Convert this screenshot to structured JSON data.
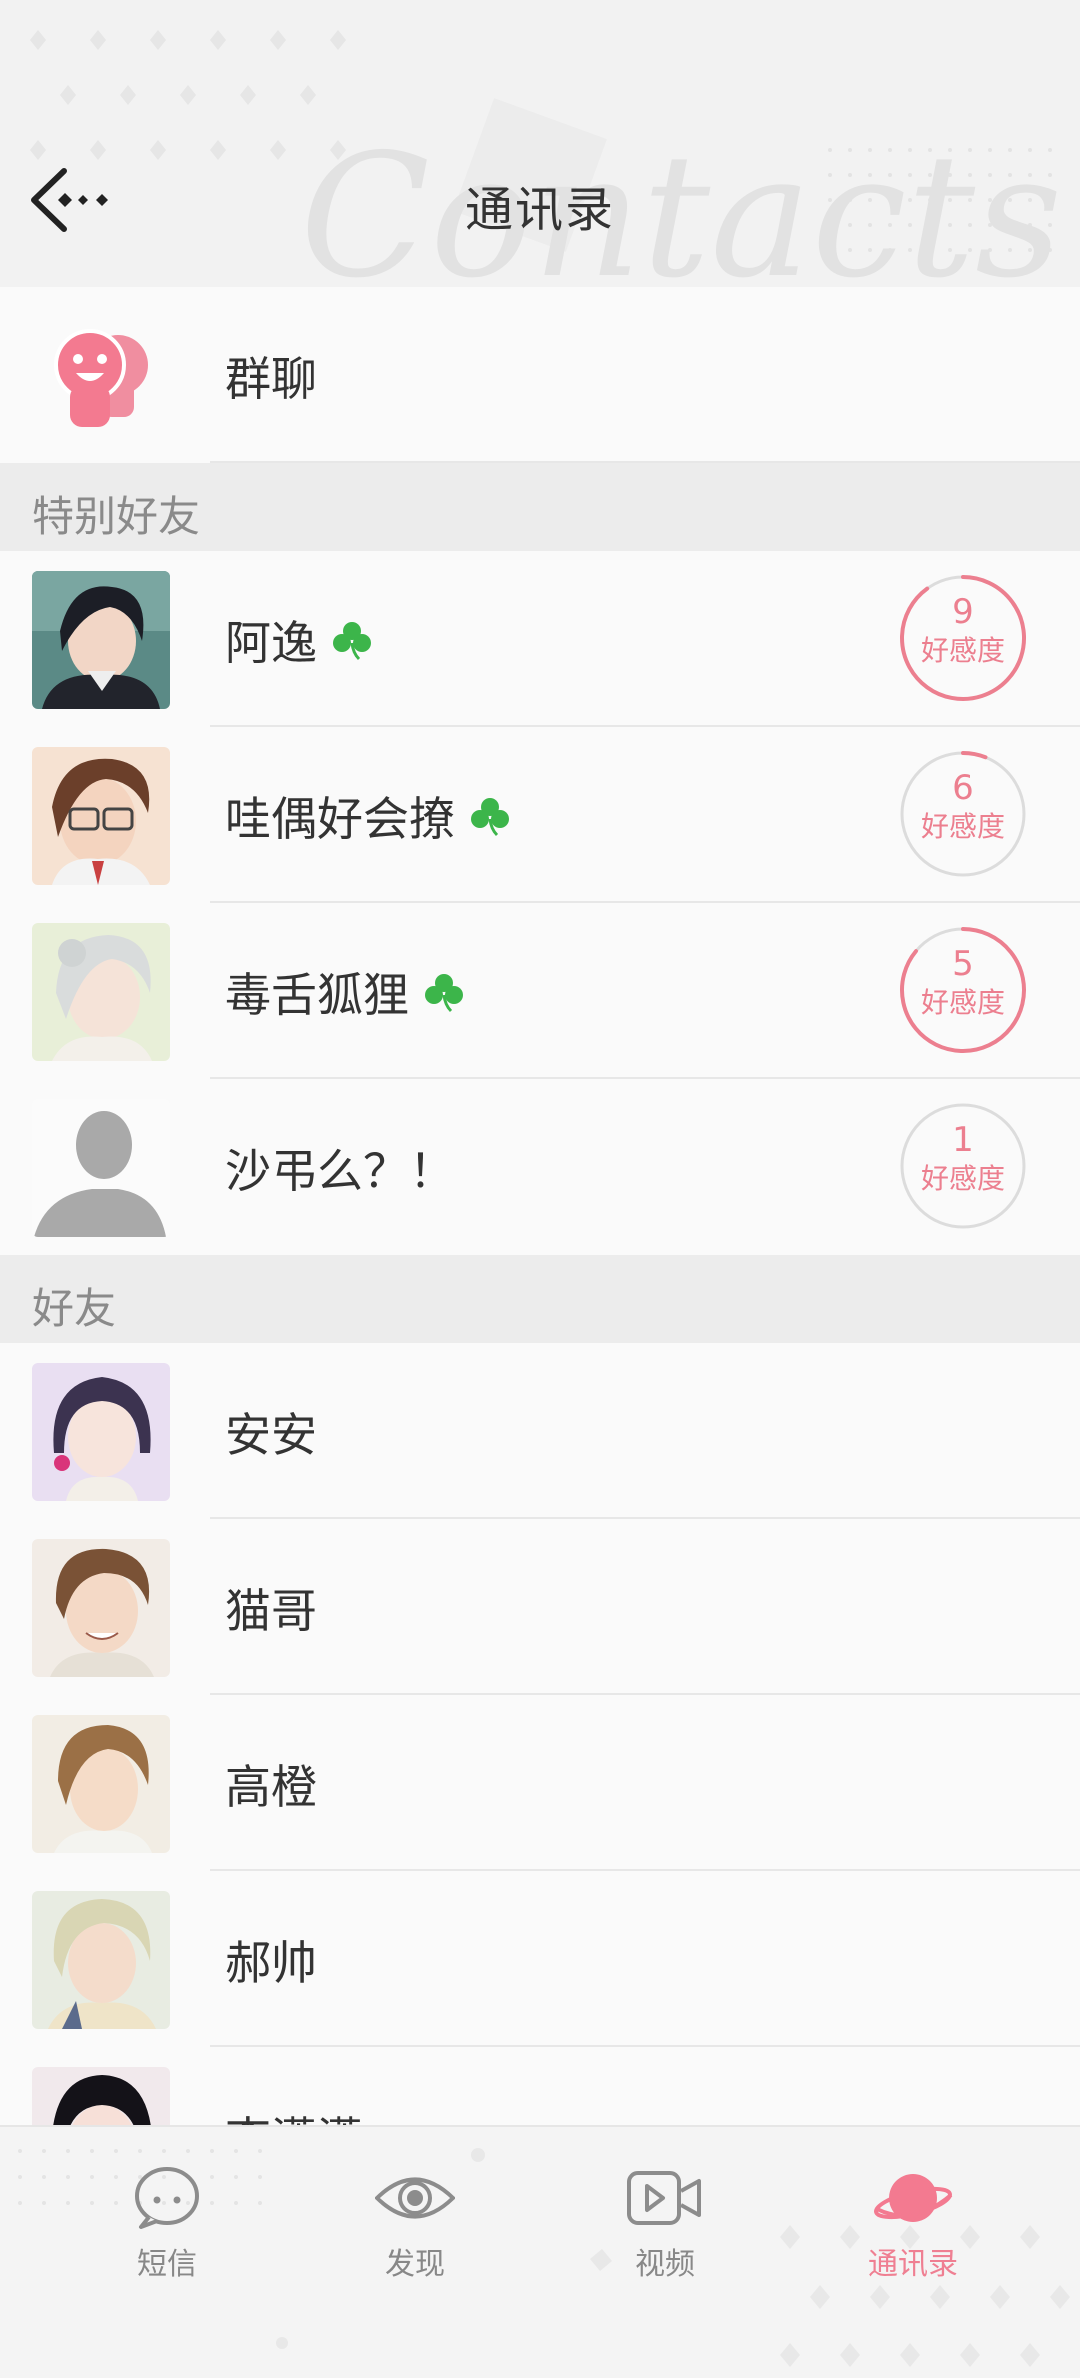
{
  "header": {
    "title": "通讯录",
    "watermark": "Contacts"
  },
  "group_chat": {
    "label": "群聊"
  },
  "sections": {
    "special": "特别好友",
    "friends": "好友"
  },
  "special_friends": [
    {
      "name": "阿逸",
      "affinity": "9",
      "affinity_label": "好感度",
      "clover": true
    },
    {
      "name": "哇偶好会撩",
      "affinity": "6",
      "affinity_label": "好感度",
      "clover": true
    },
    {
      "name": "毒舌狐狸",
      "affinity": "5",
      "affinity_label": "好感度",
      "clover": true
    },
    {
      "name": "沙弔么？！",
      "affinity": "1",
      "affinity_label": "好感度",
      "clover": false
    }
  ],
  "friends": [
    {
      "name": "安安"
    },
    {
      "name": "猫哥"
    },
    {
      "name": "高橙"
    },
    {
      "name": "郝帅"
    },
    {
      "name": "李潇潇"
    }
  ],
  "nav": {
    "items": [
      {
        "label": "短信",
        "icon": "chat-bubble-icon"
      },
      {
        "label": "发现",
        "icon": "eye-icon"
      },
      {
        "label": "视频",
        "icon": "video-icon"
      },
      {
        "label": "通讯录",
        "icon": "planet-icon"
      }
    ],
    "active_index": 3
  },
  "colors": {
    "accent": "#ef7f92",
    "clover": "#3cb54a",
    "section_bg": "#ececec"
  }
}
